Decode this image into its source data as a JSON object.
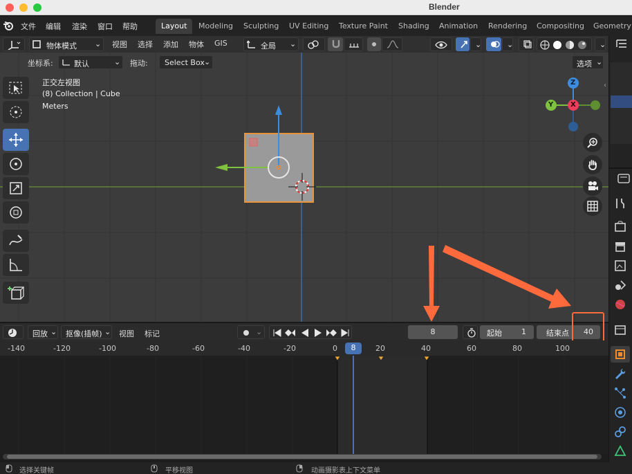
{
  "window": {
    "title": "Blender"
  },
  "menu": {
    "items": [
      "文件",
      "编辑",
      "渲染",
      "窗口",
      "帮助"
    ]
  },
  "workspaces": [
    "Layout",
    "Modeling",
    "Sculpting",
    "UV Editing",
    "Texture Paint",
    "Shading",
    "Animation",
    "Rendering",
    "Compositing",
    "Geometry N"
  ],
  "active_workspace": "Layout",
  "viewport_header": {
    "mode": "物体模式",
    "menus": [
      "视图",
      "选择",
      "添加",
      "物体",
      "GIS"
    ],
    "transform_orientation": "全局"
  },
  "tool_header": {
    "coord_label": "坐标系:",
    "coord_value": "默认",
    "drag_label": "拖动:",
    "drag_value": "Select Box",
    "options": "选项"
  },
  "viewport_overlay": {
    "view_name": "正交左视图",
    "collection": "(8) Collection | Cube",
    "units": "Meters"
  },
  "gizmo": {
    "z": "Z",
    "y": "Y",
    "x": "X"
  },
  "timeline": {
    "menus": [
      "回放",
      "抠像(插帧)",
      "视图",
      "标记"
    ],
    "current_frame": "8",
    "start_label": "起始",
    "start_value": "1",
    "end_label": "结束点",
    "end_value": "40",
    "ruler_labels": [
      "-140",
      "-120",
      "-100",
      "-80",
      "-60",
      "-40",
      "-20",
      "0",
      "20",
      "40",
      "60",
      "80",
      "100"
    ],
    "playhead_label": "8",
    "keyframes": [
      0,
      20,
      40
    ]
  },
  "status_bar": {
    "left": "选择关键帧",
    "middle": "平移视图",
    "right": "动画摄影表上下文菜单"
  },
  "annotation_color": "#ff6a3d"
}
